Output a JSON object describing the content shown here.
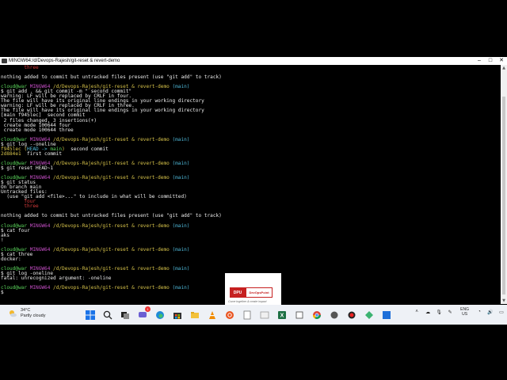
{
  "window": {
    "title": "MINGW64:/d/Devops-Rajesh/git-reset & revert-demo"
  },
  "terminal": {
    "lines": [
      [
        {
          "t": "        three",
          "c": "r"
        }
      ],
      [],
      [
        {
          "t": "nothing added to commit but untracked files present (use \"git add\" to track)"
        }
      ],
      [],
      [
        {
          "t": "cloud@war ",
          "c": "g"
        },
        {
          "t": "MINGW64 ",
          "c": "m"
        },
        {
          "t": "/d/Devops-Rajesh/git-reset & revert-demo ",
          "c": "y"
        },
        {
          "t": "(main)",
          "c": "c"
        }
      ],
      [
        {
          "t": "$ git add . && git commit -m \" second commit\""
        }
      ],
      [
        {
          "t": "warning: LF will be replaced by CRLF in four."
        }
      ],
      [
        {
          "t": "The file will have its original line endings in your working directory"
        }
      ],
      [
        {
          "t": "warning: LF will be replaced by CRLF in three."
        }
      ],
      [
        {
          "t": "The file will have its original line endings in your working directory"
        }
      ],
      [
        {
          "t": "[main f945lec]  second commit"
        }
      ],
      [
        {
          "t": " 2 files changed, 3 insertions(+)"
        }
      ],
      [
        {
          "t": " create mode 100644 four"
        }
      ],
      [
        {
          "t": " create mode 100644 three"
        }
      ],
      [],
      [
        {
          "t": "cloud@war ",
          "c": "g"
        },
        {
          "t": "MINGW64 ",
          "c": "m"
        },
        {
          "t": "/d/Devops-Rajesh/git-reset & revert-demo ",
          "c": "y"
        },
        {
          "t": "(main)",
          "c": "c"
        }
      ],
      [
        {
          "t": "$ git log --oneline"
        }
      ],
      [
        {
          "t": "f945lec ",
          "c": "y"
        },
        {
          "t": "(",
          "c": "y"
        },
        {
          "t": "HEAD -> ",
          "c": "c"
        },
        {
          "t": "main",
          "c": "g"
        },
        {
          "t": ")",
          "c": "y"
        },
        {
          "t": "  second commit"
        }
      ],
      [
        {
          "t": "2d884e1 ",
          "c": "y"
        },
        {
          "t": " first commit"
        }
      ],
      [],
      [
        {
          "t": "cloud@war ",
          "c": "g"
        },
        {
          "t": "MINGW64 ",
          "c": "m"
        },
        {
          "t": "/d/Devops-Rajesh/git-reset & revert-demo ",
          "c": "y"
        },
        {
          "t": "(main)",
          "c": "c"
        }
      ],
      [
        {
          "t": "$ git reset HEAD~1"
        }
      ],
      [],
      [
        {
          "t": "cloud@war ",
          "c": "g"
        },
        {
          "t": "MINGW64 ",
          "c": "m"
        },
        {
          "t": "/d/Devops-Rajesh/git-reset & revert-demo ",
          "c": "y"
        },
        {
          "t": "(main)",
          "c": "c"
        }
      ],
      [
        {
          "t": "$ git status"
        }
      ],
      [
        {
          "t": "On branch main"
        }
      ],
      [
        {
          "t": "Untracked files:"
        }
      ],
      [
        {
          "t": "  (use \"git add <file>...\" to include in what will be committed)"
        }
      ],
      [
        {
          "t": "        four",
          "c": "r"
        }
      ],
      [
        {
          "t": "        three",
          "c": "r"
        }
      ],
      [],
      [
        {
          "t": "nothing added to commit but untracked files present (use \"git add\" to track)"
        }
      ],
      [],
      [
        {
          "t": "cloud@war ",
          "c": "g"
        },
        {
          "t": "MINGW64 ",
          "c": "m"
        },
        {
          "t": "/d/Devops-Rajesh/git-reset & revert-demo ",
          "c": "y"
        },
        {
          "t": "(main)",
          "c": "c"
        }
      ],
      [
        {
          "t": "$ cat four"
        }
      ],
      [
        {
          "t": "aks"
        }
      ],
      [
        {
          "t": "!"
        }
      ],
      [],
      [
        {
          "t": "cloud@war ",
          "c": "g"
        },
        {
          "t": "MINGW64 ",
          "c": "m"
        },
        {
          "t": "/d/Devops-Rajesh/git-reset & revert-demo ",
          "c": "y"
        },
        {
          "t": "(main)",
          "c": "c"
        }
      ],
      [
        {
          "t": "$ cat three"
        }
      ],
      [
        {
          "t": "docker:"
        }
      ],
      [],
      [
        {
          "t": "cloud@war ",
          "c": "g"
        },
        {
          "t": "MINGW64 ",
          "c": "m"
        },
        {
          "t": "/d/Devops-Rajesh/git-reset & revert-demo ",
          "c": "y"
        },
        {
          "t": "(main)",
          "c": "c"
        }
      ],
      [
        {
          "t": "$ git log -oneline"
        }
      ],
      [
        {
          "t": "fatal: unrecognized argument: -oneline"
        }
      ],
      [],
      [
        {
          "t": "cloud@war ",
          "c": "g"
        },
        {
          "t": "MINGW64 ",
          "c": "m"
        },
        {
          "t": "/d/Devops-Rajesh/git-reset & revert-demo ",
          "c": "y"
        },
        {
          "t": "(main)",
          "c": "c"
        }
      ],
      [
        {
          "t": "$ "
        }
      ]
    ]
  },
  "logo": {
    "left": "DPU",
    "right": "DevOpsPoint",
    "tagline": "Come together & create impact"
  },
  "weather": {
    "temp": "34°C",
    "condition": "Partly cloudy"
  },
  "taskbar": {
    "icons": [
      "windows-start-icon",
      "search-icon",
      "task-view-icon",
      "chat-icon",
      "edge-icon",
      "store-icon",
      "file-explorer-icon",
      "vlc-icon",
      "ubuntu-icon",
      "app-icon",
      "app-icon",
      "excel-icon",
      "app-icon",
      "chrome-icon",
      "app-icon",
      "record-icon",
      "app-icon",
      "app-icon"
    ],
    "chat_badge": "1"
  },
  "tray": {
    "lang_1": "ENG",
    "lang_2": "US"
  },
  "colors": {
    "green": "#5ad35a",
    "magenta": "#c74ec7",
    "yellow": "#d7c34a",
    "cyan": "#4fb8d8",
    "red": "#d33a3a"
  }
}
